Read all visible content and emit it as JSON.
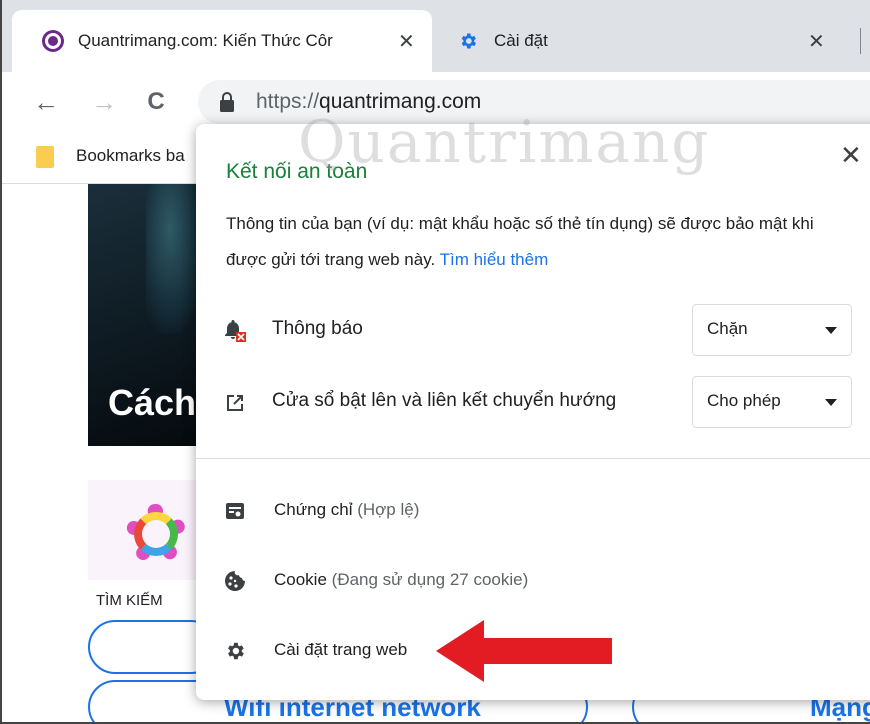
{
  "tabs": [
    {
      "title": "Quantrimang.com: Kiến Thức Côr",
      "close": "✕",
      "icon": "quantrimang-logo-icon"
    },
    {
      "title": "Cài đặt",
      "close": "✕",
      "icon": "gear-icon"
    }
  ],
  "toolbar": {
    "back": "←",
    "forward": "→",
    "reload": "C",
    "url_scheme": "https://",
    "url_host": "quantrimang.com"
  },
  "bookmarks": {
    "label": "Bookmarks ba"
  },
  "page": {
    "hero_text": "Cách",
    "search_label": "TÌM KIẾM",
    "pill_wifi": "Wifi internet network",
    "pill_mang": "Mạng"
  },
  "popup": {
    "title": "Kết nối an toàn",
    "close": "✕",
    "description": "Thông tin của bạn (ví dụ: mật khẩu hoặc số thẻ tín dụng) sẽ được bảo mật khi được gửi tới trang web này.",
    "learn_more": "Tìm hiểu thêm",
    "permissions": [
      {
        "label": "Thông báo",
        "value": "Chặn",
        "icon": "notification-blocked-icon"
      },
      {
        "label": "Cửa sổ bật lên và liên kết chuyển hướng",
        "value": "Cho phép",
        "icon": "popup-redirect-icon"
      }
    ],
    "links": [
      {
        "label": "Chứng chỉ",
        "detail": "(Hợp lệ)",
        "icon": "certificate-icon"
      },
      {
        "label": "Cookie",
        "detail": "(Đang sử dụng 27 cookie)",
        "icon": "cookie-icon"
      },
      {
        "label": "Cài đặt trang web",
        "detail": "",
        "icon": "settings-gear-icon"
      }
    ]
  },
  "watermark": "Quantrimang",
  "colors": {
    "accent_blue": "#1a73e8",
    "secure_green": "#188038",
    "arrow_red": "#e31b23",
    "tabstrip": "#dee1e6"
  }
}
